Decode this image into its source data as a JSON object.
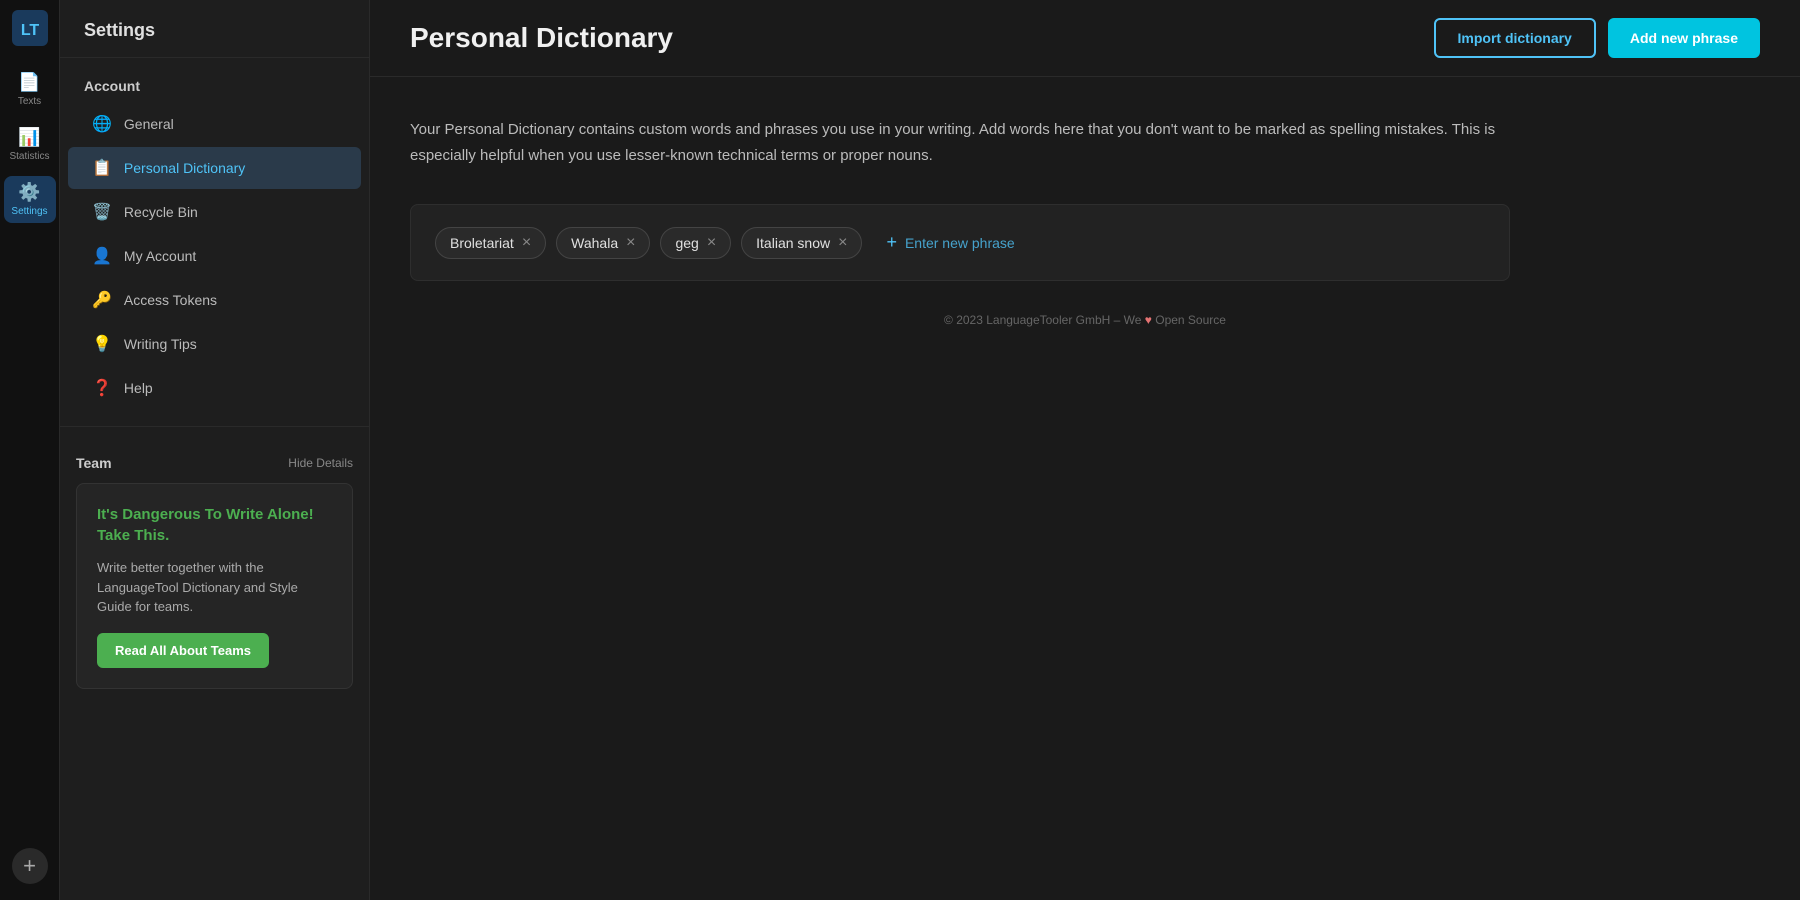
{
  "app": {
    "logo_text": "LT"
  },
  "rail": {
    "items": [
      {
        "id": "texts",
        "label": "Texts",
        "icon": "📄",
        "active": false
      },
      {
        "id": "statistics",
        "label": "Statistics",
        "icon": "📊",
        "active": false
      },
      {
        "id": "settings",
        "label": "Settings",
        "icon": "⚙️",
        "active": true
      }
    ],
    "add_label": "+"
  },
  "sidebar": {
    "header": "Settings",
    "account_section_label": "Account",
    "items": [
      {
        "id": "general",
        "label": "General",
        "icon": "🌐",
        "active": false
      },
      {
        "id": "personal-dictionary",
        "label": "Personal Dictionary",
        "icon": "📋",
        "active": true
      },
      {
        "id": "recycle-bin",
        "label": "Recycle Bin",
        "icon": "🗑️",
        "active": false
      },
      {
        "id": "my-account",
        "label": "My Account",
        "icon": "👤",
        "active": false
      },
      {
        "id": "access-tokens",
        "label": "Access Tokens",
        "icon": "🔑",
        "active": false
      },
      {
        "id": "writing-tips",
        "label": "Writing Tips",
        "icon": "💡",
        "active": false
      },
      {
        "id": "help",
        "label": "Help",
        "icon": "❓",
        "active": false
      }
    ],
    "team_label": "Team",
    "hide_details_label": "Hide Details",
    "team_card": {
      "title": "It's Dangerous To Write Alone! Take This.",
      "description": "Write better together with the LanguageTool Dictionary and Style Guide for teams.",
      "button_label": "Read All About Teams"
    }
  },
  "main": {
    "page_title": "Personal Dictionary",
    "import_button_label": "Import dictionary",
    "add_phrase_button_label": "Add new phrase",
    "description": "Your Personal Dictionary contains custom words and phrases you use in your writing. Add words here that you don't want to be marked as spelling mistakes. This is especially helpful when you use lesser-known technical terms or proper nouns.",
    "tags": [
      {
        "id": "broletariat",
        "label": "Broletariat"
      },
      {
        "id": "wahala",
        "label": "Wahala"
      },
      {
        "id": "geg",
        "label": "geg"
      },
      {
        "id": "italian-snow",
        "label": "Italian snow"
      }
    ],
    "enter_phrase_placeholder": "Enter new phrase",
    "footer": "© 2023 LanguageTooler GmbH – We ♥ Open Source"
  }
}
